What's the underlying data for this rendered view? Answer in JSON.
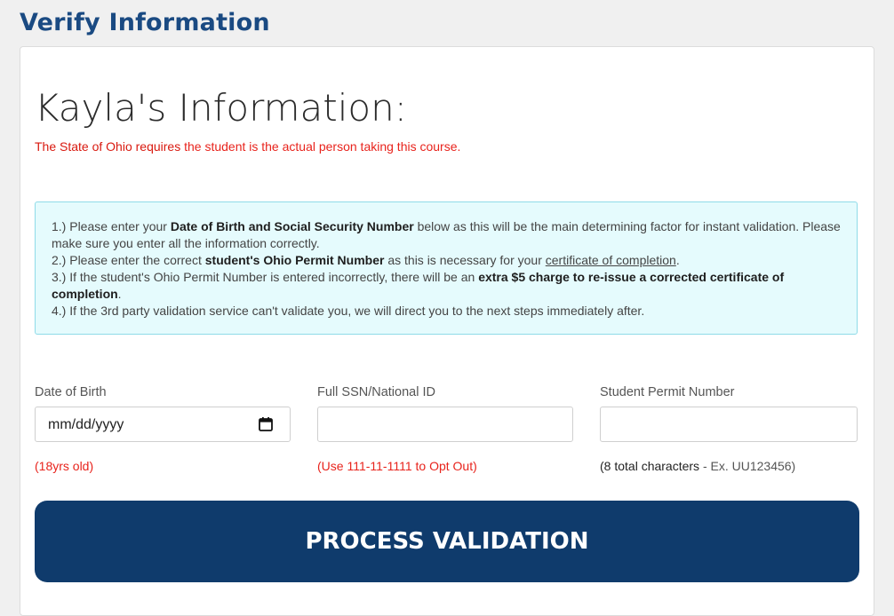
{
  "page": {
    "heading": "Verify Information"
  },
  "student": {
    "heading": "Kayla's Information:",
    "requirement_bold": "The State of Ohio requires",
    "requirement_rest": " the student is the actual person taking this course."
  },
  "instructions": {
    "item1_pre": "1.) Please enter your ",
    "item1_bold": "Date of Birth and Social Security Number",
    "item1_post": " below as this will be the main determining factor for instant validation. Please make sure you enter all the information correctly.",
    "item2_pre": "2.) Please enter the correct ",
    "item2_bold": "student's Ohio Permit Number",
    "item2_mid": " as this is necessary for your ",
    "item2_link": "certificate of completion",
    "item2_post": ".",
    "item3_pre": "3.) If the student's Ohio Permit Number is entered incorrectly, there will be an ",
    "item3_bold": "extra $5 charge to re-issue a corrected certificate of completion",
    "item3_post": ".",
    "item4": "4.) If the 3rd party validation service can't validate you, we will direct you to the next steps immediately after."
  },
  "form": {
    "dob": {
      "label": "Date of Birth",
      "value": "mm/dd/yyyy",
      "hint": "(18yrs old)",
      "icon": "calendar-icon"
    },
    "ssn": {
      "label": "Full SSN/National ID",
      "value": "",
      "hint": "(Use 111-11-1111 to Opt Out)"
    },
    "permit": {
      "label": "Student Permit Number",
      "value": "",
      "hint_bold": "(8 total characters",
      "hint_rest": " - Ex. UU123456)"
    }
  },
  "actions": {
    "process_label": "PROCESS VALIDATION"
  },
  "colors": {
    "heading_blue": "#1a4a82",
    "button_navy": "#0f3b6c",
    "warning_red": "#e8231c",
    "info_bg": "#e5fbfd",
    "info_border": "#8fdbe8"
  }
}
